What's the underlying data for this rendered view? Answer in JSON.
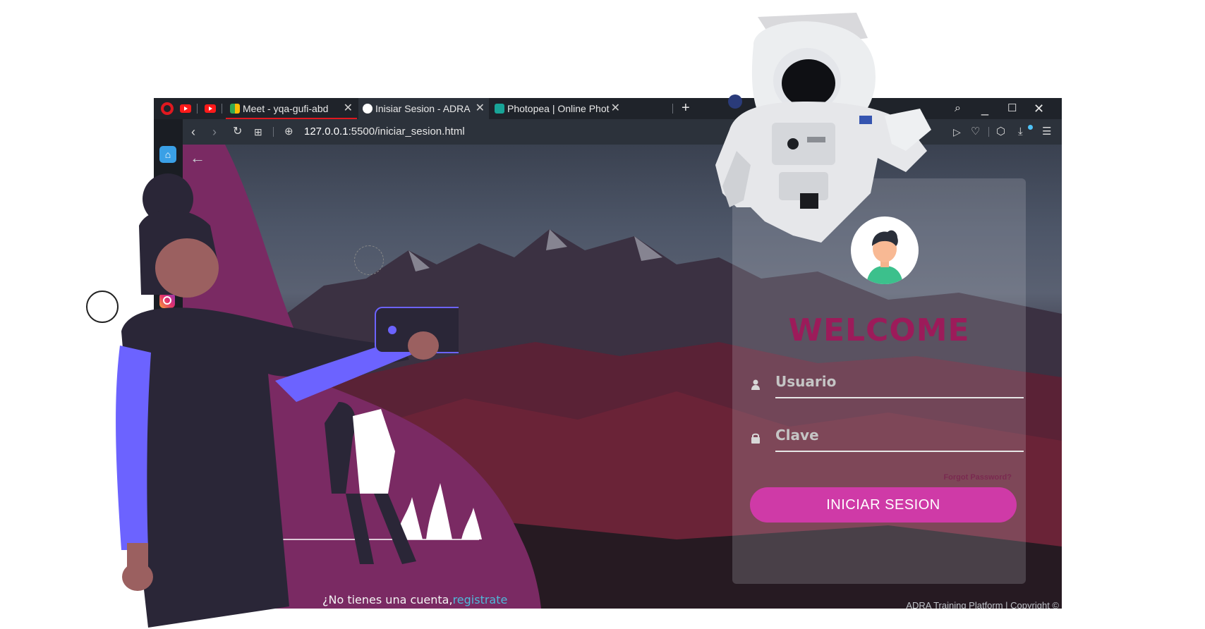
{
  "browser": {
    "tabs": [
      {
        "label": "Meet - yqa-gufi-abd",
        "close": "✕"
      },
      {
        "label": "Inisiar Sesion - ADRA",
        "close": "✕"
      },
      {
        "label": "Photopea | Online Phot",
        "close": "✕"
      }
    ],
    "new_tab": "+",
    "url_host": "127.0.0.1",
    "url_rest": ":5500/iniciar_sesion.html",
    "icons": [
      "opera-icon",
      "youtube-icon",
      "meet-icon",
      "adra-icon",
      "photopea-icon",
      "back-icon",
      "forward-icon",
      "reload-icon",
      "tabs-grid-icon",
      "globe-icon",
      "search-icon",
      "minimize-icon",
      "maximize-icon",
      "close-icon",
      "send-icon",
      "heart-icon",
      "cube-icon",
      "download-icon",
      "menu-icon",
      "home-icon",
      "instagram-icon"
    ]
  },
  "login": {
    "welcome": "WELCOME",
    "user_placeholder": "Usuario",
    "password_placeholder": "Clave",
    "forgot": "Forgot Password?",
    "button": "INICIAR SESION"
  },
  "footer": {
    "no_account": "¿No tienes una cuenta,",
    "register": "registrate",
    "copyright": "ADRA Training Platform | Copyright ©"
  },
  "colors": {
    "accent": "#cf3aa7",
    "welcome": "#9c1b5a",
    "purple_blob": "#7a2a63",
    "link": "#4fb9d9"
  }
}
